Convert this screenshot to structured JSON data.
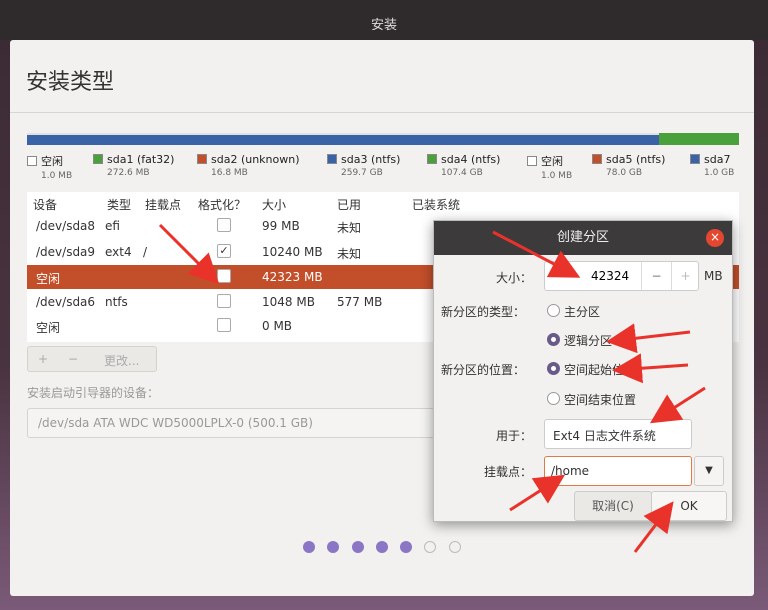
{
  "window": {
    "title": "安装"
  },
  "page": {
    "title": "安装类型"
  },
  "colors": {
    "accent": "#c34f2a",
    "fat32": "#4aa03a",
    "unknown": "#c34f2a",
    "ntfs": "#3a62a6",
    "free": "#ffffff",
    "dialog_close": "#e3472f",
    "arrow": "#e8322a"
  },
  "legend": [
    {
      "name": "空闲",
      "size": "1.0 MB",
      "color": "#ffffff"
    },
    {
      "name": "sda1 (fat32)",
      "size": "272.6 MB",
      "color": "#4aa03a"
    },
    {
      "name": "sda2 (unknown)",
      "size": "16.8 MB",
      "color": "#c34f2a"
    },
    {
      "name": "sda3 (ntfs)",
      "size": "259.7 GB",
      "color": "#3a62a6"
    },
    {
      "name": "sda4 (ntfs)",
      "size": "107.4 GB",
      "color": "#4aa03a"
    },
    {
      "name": "空闲",
      "size": "1.0 MB",
      "color": "#ffffff"
    },
    {
      "name": "sda5 (ntfs)",
      "size": "78.0 GB",
      "color": "#c34f2a"
    },
    {
      "name": "sda7",
      "size": "1.0 GB",
      "color": "#3a62a6"
    }
  ],
  "table": {
    "headers": [
      "设备",
      "类型",
      "挂载点",
      "格式化？",
      "大小",
      "已用",
      "已装系统"
    ],
    "rows": [
      {
        "device": "/dev/sda8",
        "type": "efi",
        "mount": "",
        "format": false,
        "size": "99 MB",
        "used": "未知"
      },
      {
        "device": "/dev/sda9",
        "type": "ext4",
        "mount": "/",
        "format": true,
        "size": "10240 MB",
        "used": "未知"
      },
      {
        "device": "空闲",
        "type": "",
        "mount": "",
        "format": false,
        "size": "42323 MB",
        "used": "",
        "selected": true
      },
      {
        "device": "/dev/sda6",
        "type": "ntfs",
        "mount": "",
        "format": false,
        "size": "1048 MB",
        "used": "577 MB"
      },
      {
        "device": "空闲",
        "type": "",
        "mount": "",
        "format": false,
        "size": "0 MB",
        "used": ""
      }
    ]
  },
  "buttons": {
    "add": "+",
    "remove": "−",
    "change": "更改..."
  },
  "boot": {
    "label": "安装启动引导器的设备：",
    "value": "/dev/sda   ATA WDC WD5000LPLX-0 (500.1 GB)"
  },
  "dialog": {
    "title": "创建分区",
    "close_icon": "×",
    "size_label": "大小：",
    "size_value": "42324",
    "size_unit": "MB",
    "minus": "−",
    "plus": "+",
    "type_label": "新分区的类型：",
    "type_primary": "主分区",
    "type_logical": "逻辑分区",
    "location_label": "新分区的位置：",
    "location_start": "空间起始位置",
    "location_end": "空间结束位置",
    "use_label": "用于：",
    "use_value": "Ext4 日志文件系统",
    "mount_label": "挂载点：",
    "mount_value": "/home",
    "cancel": "取消(C)",
    "ok": "OK"
  },
  "progress": {
    "total_steps": 7,
    "completed_steps": 5
  }
}
